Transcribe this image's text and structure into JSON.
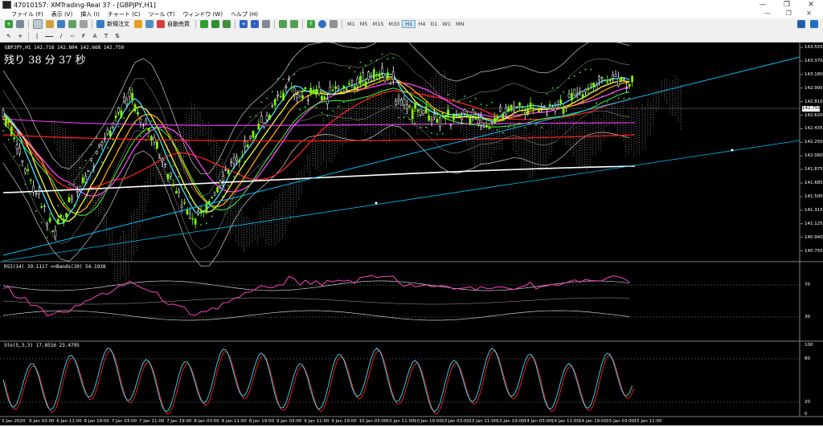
{
  "window": {
    "title": "47010157: XMTrading-Real 37 - [GBPJPY,H1]"
  },
  "menu": [
    "ファイル (F)",
    "表示 (V)",
    "挿入 (I)",
    "チャート (C)",
    "ツール (T)",
    "ウィンドウ (W)",
    "ヘルプ (H)"
  ],
  "toolbar": {
    "new_order": "新規注文",
    "auto_trade": "自動売買",
    "timeframes": [
      "M1",
      "M5",
      "M15",
      "M30",
      "H1",
      "H4",
      "D1",
      "W1",
      "MN"
    ],
    "active_timeframe": "H1"
  },
  "chart": {
    "symbol_info": "GBPJPY,H1  142.718 142.804 142.668 142.750",
    "countdown": "残り 38 分 37 秒",
    "current_price": "142.750",
    "price_axis": [
      "143.555",
      "143.370",
      "143.180",
      "142.995",
      "142.810",
      "142.620",
      "142.435",
      "142.250",
      "142.060",
      "141.875",
      "141.685",
      "141.500",
      "141.315",
      "141.125",
      "140.940",
      "140.755"
    ],
    "rsi_label": "RSI(14) 39.1117  <<Bands(20) 54.1938",
    "rsi_axis": [
      "70",
      "30"
    ],
    "stoch_label": "Sto(5,3,3) 17.8516 23.4795",
    "stoch_axis": [
      "100",
      "80",
      "20",
      "0"
    ],
    "time_axis": [
      "3 Jan 2020",
      "6 Jan 03:00",
      "6 Jan 11:00",
      "6 Jan 19:00",
      "7 Jan 03:00",
      "7 Jan 11:00",
      "7 Jan 19:00",
      "8 Jan 03:00",
      "8 Jan 11:00",
      "8 Jan 19:00",
      "9 Jan 03:00",
      "9 Jan 11:00",
      "9 Jan 19:00",
      "10 Jan 03:00",
      "10 Jan 11:00",
      "10 Jan 19:00",
      "13 Jan 03:00",
      "13 Jan 11:00",
      "13 Jan 19:00",
      "14 Jan 03:00",
      "14 Jan 11:00",
      "14 Jan 19:00",
      "15 Jan 03:00",
      "15 Jan 11:00"
    ]
  },
  "colors": {
    "background": "#000000",
    "bull_candle": "#7fff00",
    "bear_candle": "#ffffff",
    "trendline": "#00bfff",
    "ma_red": "#ff2020",
    "ma_white": "#ffffff",
    "ma_magenta": "#ff40ff",
    "ma_cyan": "#40e0ff",
    "ma_orange": "#ffa500",
    "ma_yellow": "#ffff40",
    "rsi_line": "#ff40c0",
    "stoch_main": "#40e0ff",
    "stoch_signal": "#ff2020"
  }
}
